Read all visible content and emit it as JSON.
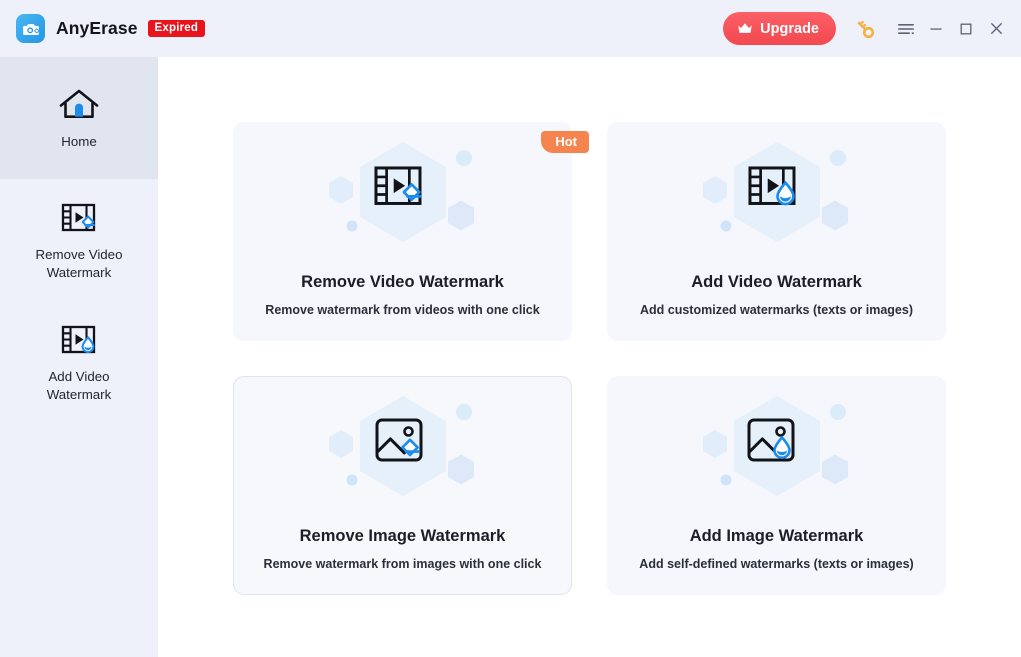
{
  "window": {
    "app_name": "AnyErase",
    "status_badge": "Expired",
    "logo_icon": "camera-erase-icon",
    "controls": {
      "upgrade_label": "Upgrade",
      "upgrade_icon": "crown-icon",
      "key_icon": "key-icon",
      "menu_icon": "hamburger-menu-icon",
      "minimize_icon": "minimize-icon",
      "maximize_icon": "maximize-icon",
      "close_icon": "close-icon"
    },
    "colors": {
      "titlebar_bg": "#eef1f9",
      "sidebar_bg": "#eef1f9",
      "sidebar_active_bg": "#e1e5ef",
      "card_bg": "#f5f7fc",
      "accent_blue": "#1b8bec",
      "upgrade_red": "#f3484f",
      "expired_red": "#e8131b",
      "hot_orange": "#f5844f",
      "hex_decor": "#e3effb"
    }
  },
  "sidebar": {
    "items": [
      {
        "id": "home",
        "label": "Home",
        "icon": "home-icon",
        "active": true
      },
      {
        "id": "remove-video-watermark",
        "label_line1": "Remove Video",
        "label_line2": "Watermark",
        "icon": "video-eraser-icon",
        "active": false
      },
      {
        "id": "add-video-watermark",
        "label_line1": "Add Video",
        "label_line2": "Watermark",
        "icon": "video-droplet-icon",
        "active": false
      }
    ]
  },
  "main": {
    "cards": [
      {
        "id": "remove-video-watermark",
        "title": "Remove Video Watermark",
        "subtitle": "Remove watermark from videos with one click",
        "badge": "Hot",
        "icon": "video-eraser-icon",
        "highlighted": false
      },
      {
        "id": "add-video-watermark",
        "title": "Add Video Watermark",
        "subtitle": "Add customized watermarks (texts or images)",
        "badge": "",
        "icon": "video-droplet-icon",
        "highlighted": false
      },
      {
        "id": "remove-image-watermark",
        "title": "Remove Image Watermark",
        "subtitle": "Remove watermark from images with one click",
        "badge": "",
        "icon": "image-eraser-icon",
        "highlighted": true
      },
      {
        "id": "add-image-watermark",
        "title": "Add Image Watermark",
        "subtitle": "Add self-defined watermarks  (texts or images)",
        "badge": "",
        "icon": "image-droplet-icon",
        "highlighted": false
      }
    ]
  }
}
